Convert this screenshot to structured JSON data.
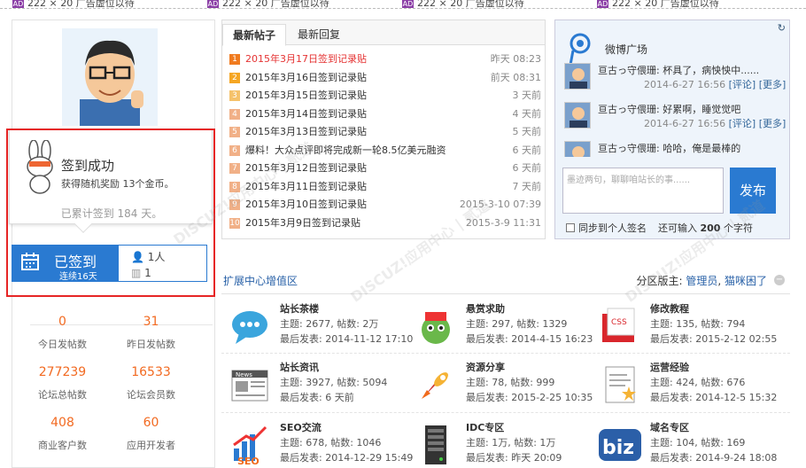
{
  "ad_strip": {
    "badge": "AD",
    "items": [
      "222 × 20 广告虚位以待",
      "222 × 20 广告虚位以待",
      "222 × 20 广告虚位以待",
      "222 × 20 广告虚位以待"
    ]
  },
  "sign": {
    "title": "签到成功",
    "reward": "获得随机奖励 13个金币。",
    "total": "已累计签到 184 天。",
    "button_label": "已签到",
    "streak": "连续16天",
    "people": "1人",
    "rank": "1"
  },
  "stats": [
    {
      "value": "0",
      "label": "今日发帖数"
    },
    {
      "value": "31",
      "label": "昨日发帖数"
    },
    {
      "value": "277239",
      "label": "论坛总帖数"
    },
    {
      "value": "16533",
      "label": "论坛会员数"
    },
    {
      "value": "408",
      "label": "商业客户数"
    },
    {
      "value": "60",
      "label": "应用开发者"
    }
  ],
  "posts": {
    "tabs": [
      "最新帖子",
      "最新回复"
    ],
    "items": [
      {
        "num": "1",
        "title": "2015年3月17日签到记录贴",
        "time": "昨天 08:23",
        "hot": true
      },
      {
        "num": "2",
        "title": "2015年3月16日签到记录贴",
        "time": "前天 08:31",
        "hot": false
      },
      {
        "num": "3",
        "title": "2015年3月15日签到记录贴",
        "time": "3 天前",
        "hot": false
      },
      {
        "num": "4",
        "title": "2015年3月14日签到记录贴",
        "time": "4 天前",
        "hot": false
      },
      {
        "num": "5",
        "title": "2015年3月13日签到记录贴",
        "time": "5 天前",
        "hot": false
      },
      {
        "num": "6",
        "title": "爆料！大众点评即将完成新一轮8.5亿美元融资",
        "time": "6 天前",
        "hot": false
      },
      {
        "num": "7",
        "title": "2015年3月12日签到记录贴",
        "time": "6 天前",
        "hot": false
      },
      {
        "num": "8",
        "title": "2015年3月11日签到记录贴",
        "time": "7 天前",
        "hot": false
      },
      {
        "num": "9",
        "title": "2015年3月10日签到记录贴",
        "time": "2015-3-10 07:39",
        "hot": false
      },
      {
        "num": "10",
        "title": "2015年3月9日签到记录贴",
        "time": "2015-3-9 11:31",
        "hot": false
      }
    ]
  },
  "weibo": {
    "title": "微博广场",
    "feeds": [
      {
        "text": "亘古っ守偎珊: 杯具了，病怏怏中......",
        "date": "2014-6-27 16:56",
        "comment": "[评论]",
        "more": "[更多]"
      },
      {
        "text": "亘古っ守偎珊: 好累啊，睡觉觉吧",
        "date": "2014-6-27 16:56",
        "comment": "[评论]",
        "more": "[更多]"
      },
      {
        "text": "亘古っ守偎珊: 哈哈，俺是最棒的",
        "date": "",
        "comment": "",
        "more": ""
      }
    ],
    "placeholder": "墨迹两句，聊聊咱站长的事......",
    "post_button": "发布",
    "sync_label": "同步到个人签名",
    "char_prefix": "还可输入",
    "char_count": "200",
    "char_suffix": "个字符"
  },
  "ext": {
    "title": "扩展中心增值区",
    "mods_label": "分区版主:",
    "mod1": "管理员",
    "mod2": "猫咪困了",
    "forums": [
      {
        "name": "站长茶楼",
        "stats": "主题: 2677, 帖数: 2万",
        "last": "最后发表: 2014-11-12 17:10",
        "icon": "chat-bubble-icon"
      },
      {
        "name": "悬赏求助",
        "stats": "主题: 297, 帖数: 1329",
        "last": "最后发表: 2014-4-15 16:23",
        "icon": "mascot-icon"
      },
      {
        "name": "修改教程",
        "stats": "主题: 135, 帖数: 794",
        "last": "最后发表: 2015-2-12 02:55",
        "icon": "css-file-icon"
      },
      {
        "name": "站长资讯",
        "stats": "主题: 3927, 帖数: 5094",
        "last": "最后发表: 6 天前",
        "icon": "news-icon"
      },
      {
        "name": "资源分享",
        "stats": "主题: 78, 帖数: 999",
        "last": "最后发表: 2015-2-25 10:35",
        "icon": "rocket-icon"
      },
      {
        "name": "运营经验",
        "stats": "主题: 424, 帖数: 676",
        "last": "最后发表: 2014-12-5 15:32",
        "icon": "document-star-icon"
      },
      {
        "name": "SEO交流",
        "stats": "主题: 678, 帖数: 1046",
        "last": "最后发表: 2014-12-29 15:49",
        "icon": "seo-chart-icon"
      },
      {
        "name": "IDC专区",
        "stats": "主题: 1万, 帖数: 1万",
        "last": "最后发表: 昨天 20:09",
        "icon": "server-icon"
      },
      {
        "name": "域名专区",
        "stats": "主题: 104, 帖数: 169",
        "last": "最后发表: 2014-9-24 18:08",
        "icon": "biz-icon"
      }
    ]
  },
  "colors": {
    "accent_blue": "#2a7ad1",
    "orange": "#f26a21",
    "red_border": "#e62525",
    "link": "#2a62a8"
  }
}
